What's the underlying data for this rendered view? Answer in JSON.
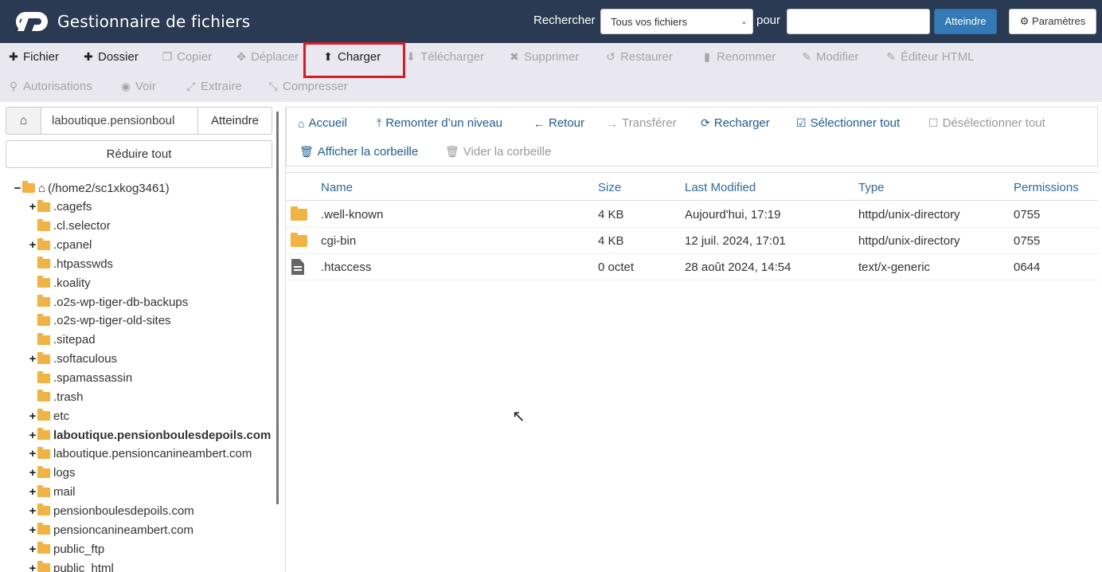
{
  "header": {
    "title": "Gestionnaire de fichiers",
    "search_label": "Rechercher",
    "search_scope": "Tous vos fichiers",
    "pour_label": "pour",
    "search_value": "",
    "go_label": "Atteindre",
    "settings_label": "Paramètres"
  },
  "toolbar": {
    "row1": [
      {
        "label": "Fichier",
        "icon": "plus-icon",
        "enabled": true
      },
      {
        "label": "Dossier",
        "icon": "plus-icon",
        "enabled": true
      },
      {
        "label": "Copier",
        "icon": "copy-icon",
        "enabled": false
      },
      {
        "label": "Déplacer",
        "icon": "move-icon",
        "enabled": false
      },
      {
        "label": "Charger",
        "icon": "upload-icon",
        "enabled": true
      },
      {
        "label": "Télécharger",
        "icon": "download-icon",
        "enabled": false
      },
      {
        "label": "Supprimer",
        "icon": "close-icon",
        "enabled": false
      },
      {
        "label": "Restaurer",
        "icon": "undo-icon",
        "enabled": false
      },
      {
        "label": "Renommer",
        "icon": "file-icon",
        "enabled": false
      },
      {
        "label": "Modifier",
        "icon": "pencil-icon",
        "enabled": false
      },
      {
        "label": "Éditeur HTML",
        "icon": "edit-icon",
        "enabled": false
      }
    ],
    "row2": [
      {
        "label": "Autorisations",
        "icon": "key-icon",
        "enabled": false
      },
      {
        "label": "Voir",
        "icon": "eye-icon",
        "enabled": false
      },
      {
        "label": "Extraire",
        "icon": "expand-icon",
        "enabled": false
      },
      {
        "label": "Compresser",
        "icon": "compress-icon",
        "enabled": false
      }
    ]
  },
  "left": {
    "path_value": "laboutique.pensionboul",
    "path_go": "Atteindre",
    "collapse_label": "Réduire tout",
    "tree": [
      {
        "label": "(/home2/sc1xkog3461)",
        "exp": "−",
        "root": true
      },
      {
        "label": ".cagefs",
        "exp": "+"
      },
      {
        "label": ".cl.selector",
        "exp": ""
      },
      {
        "label": ".cpanel",
        "exp": "+"
      },
      {
        "label": ".htpasswds",
        "exp": ""
      },
      {
        "label": ".koality",
        "exp": ""
      },
      {
        "label": ".o2s-wp-tiger-db-backups",
        "exp": ""
      },
      {
        "label": ".o2s-wp-tiger-old-sites",
        "exp": ""
      },
      {
        "label": ".sitepad",
        "exp": ""
      },
      {
        "label": ".softaculous",
        "exp": "+"
      },
      {
        "label": ".spamassassin",
        "exp": ""
      },
      {
        "label": ".trash",
        "exp": ""
      },
      {
        "label": "etc",
        "exp": "+"
      },
      {
        "label": "laboutique.pensionboulesdepoils.com",
        "exp": "+",
        "bold": true
      },
      {
        "label": "laboutique.pensioncanineambert.com",
        "exp": "+"
      },
      {
        "label": "logs",
        "exp": "+"
      },
      {
        "label": "mail",
        "exp": "+"
      },
      {
        "label": "pensionboulesdepoils.com",
        "exp": "+"
      },
      {
        "label": "pensioncanineambert.com",
        "exp": "+"
      },
      {
        "label": "public_ftp",
        "exp": "+"
      },
      {
        "label": "public_html",
        "exp": "+"
      }
    ]
  },
  "nav": {
    "row1": [
      {
        "label": "Accueil",
        "icon": "home-icon",
        "enabled": true
      },
      {
        "label": "Remonter d’un niveau",
        "icon": "level-up-icon",
        "enabled": true
      },
      {
        "label": "Retour",
        "icon": "arrow-left-icon",
        "enabled": true
      },
      {
        "label": "Transférer",
        "icon": "arrow-right-icon",
        "enabled": false
      },
      {
        "label": "Recharger",
        "icon": "refresh-icon",
        "enabled": true
      },
      {
        "label": "Sélectionner tout",
        "icon": "checked-box-icon",
        "enabled": true
      },
      {
        "label": "Désélectionner tout",
        "icon": "empty-box-icon",
        "enabled": false
      }
    ],
    "row2": [
      {
        "label": "Afficher la corbeille",
        "icon": "trash-icon",
        "enabled": true
      },
      {
        "label": "Vider la corbeille",
        "icon": "trash-icon",
        "enabled": false
      }
    ]
  },
  "table": {
    "headers": {
      "name": "Name",
      "size": "Size",
      "modified": "Last Modified",
      "type": "Type",
      "perms": "Permissions"
    },
    "rows": [
      {
        "kind": "folder",
        "name": ".well-known",
        "size": "4 KB",
        "modified": "Aujourd'hui, 17:19",
        "type": "httpd/unix-directory",
        "perms": "0755"
      },
      {
        "kind": "folder",
        "name": "cgi-bin",
        "size": "4 KB",
        "modified": "12 juil. 2024, 17:01",
        "type": "httpd/unix-directory",
        "perms": "0755"
      },
      {
        "kind": "file",
        "name": ".htaccess",
        "size": "0 octet",
        "modified": "28 août 2024, 14:54",
        "type": "text/x-generic",
        "perms": "0644"
      }
    ]
  },
  "colors": {
    "header_bg": "#2a3a53",
    "toolbar_bg": "#e9e7ef",
    "accent": "#337ab7",
    "highlight": "#d81b24",
    "folder": "#f0b344"
  }
}
